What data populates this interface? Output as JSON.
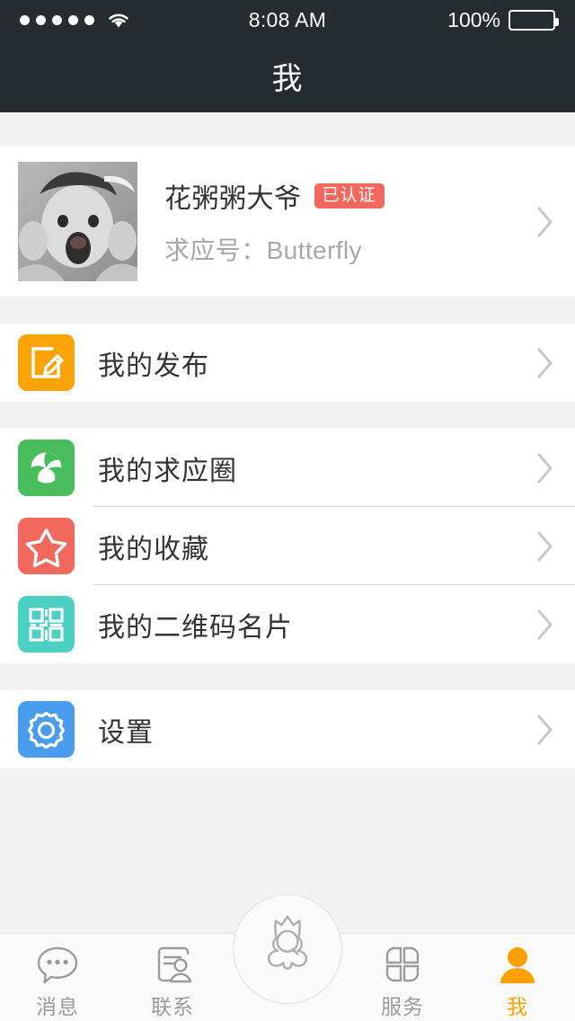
{
  "statusbar": {
    "signal_dots": 5,
    "wifi_icon": "wifi-icon",
    "time": "8:08 AM",
    "battery_percent": "100%",
    "battery_icon": "battery-full-icon"
  },
  "navbar": {
    "title": "我"
  },
  "profile": {
    "avatar_icon": "user-avatar-photo",
    "name": "花粥粥大爷",
    "badge": "已认证",
    "badge_color": "#F2685C",
    "id_label": "求应号：Butterfly",
    "chevron_icon": "chevron-right-icon"
  },
  "menu_groups": [
    {
      "items": [
        {
          "label": "我的发布",
          "icon": "edit-note-icon",
          "color": "#FAA309",
          "chevron_icon": "chevron-right-icon"
        }
      ]
    },
    {
      "items": [
        {
          "label": "我的求应圈",
          "icon": "shutter-circle-icon",
          "color": "#49BC5C",
          "chevron_icon": "chevron-right-icon"
        },
        {
          "label": "我的收藏",
          "icon": "star-icon",
          "color": "#F2685C",
          "chevron_icon": "chevron-right-icon"
        },
        {
          "label": "我的二维码名片",
          "icon": "qr-code-icon",
          "color": "#4DD0C4",
          "chevron_icon": "chevron-right-icon"
        }
      ]
    },
    {
      "items": [
        {
          "label": "设置",
          "icon": "gear-icon",
          "color": "#4A9DEE",
          "chevron_icon": "chevron-right-icon"
        }
      ]
    }
  ],
  "tabbar": {
    "active_color": "#FFA000",
    "inactive_color": "#9B9B9B",
    "tabs": [
      {
        "label": "消息",
        "icon": "chat-bubble-icon",
        "active": false
      },
      {
        "label": "联系",
        "icon": "contact-card-icon",
        "active": false
      },
      {
        "label": "",
        "icon": "mascot-logo-icon",
        "active": false,
        "center": true
      },
      {
        "label": "服务",
        "icon": "grid-apps-icon",
        "active": false
      },
      {
        "label": "我",
        "icon": "person-icon",
        "active": true
      }
    ]
  }
}
